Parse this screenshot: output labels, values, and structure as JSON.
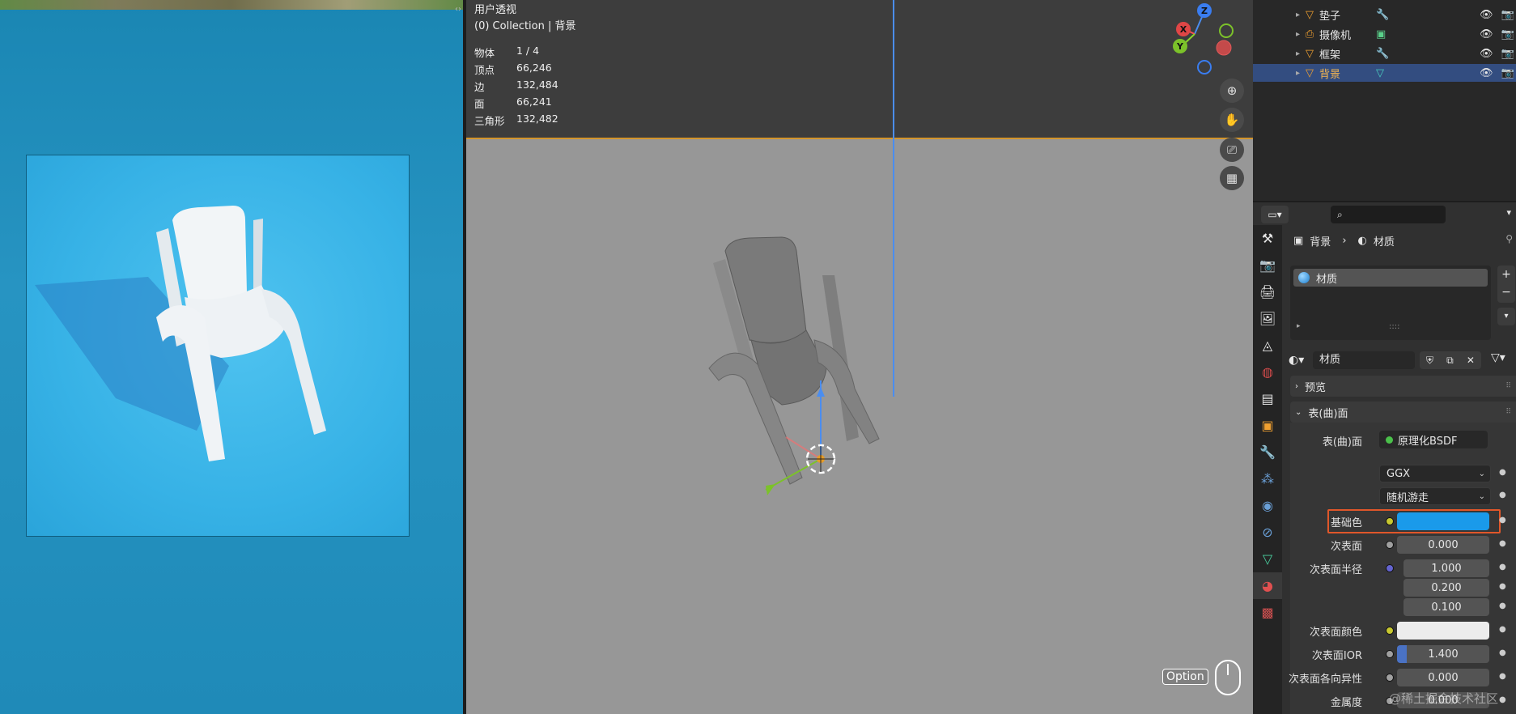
{
  "viewport": {
    "view_name": "用户透视",
    "collection_line": "(0) Collection | 背景",
    "stats": [
      {
        "key": "物体",
        "value": "1 / 4"
      },
      {
        "key": "顶点",
        "value": "66,246"
      },
      {
        "key": "边",
        "value": "132,484"
      },
      {
        "key": "面",
        "value": "66,241"
      },
      {
        "key": "三角形",
        "value": "132,482"
      }
    ],
    "gizmo": {
      "x": "X",
      "y": "Y",
      "z": "Z"
    },
    "option_badge": "Option"
  },
  "outliner": {
    "items": [
      {
        "name": "垫子",
        "selected": false
      },
      {
        "name": "摄像机",
        "selected": false
      },
      {
        "name": "框架",
        "selected": false
      },
      {
        "name": "背景",
        "selected": true
      }
    ]
  },
  "properties": {
    "breadcrumb_object": "背景",
    "breadcrumb_material": "材质",
    "slot_name": "材质",
    "material_name": "材质",
    "panel_preview": "预览",
    "panel_surface": "表(曲)面",
    "surface_label": "表(曲)面",
    "surface_value": "原理化BSDF",
    "distribution": "GGX",
    "subsurface_method": "随机游走",
    "rows": {
      "base_color": "基础色",
      "subsurface": "次表面",
      "subsurface_value": "0.000",
      "subsurface_radius": "次表面半径",
      "radius_values": [
        "1.000",
        "0.200",
        "0.100"
      ],
      "subsurface_color": "次表面颜色",
      "subsurface_ior": "次表面IOR",
      "subsurface_ior_value": "1.400",
      "subsurface_aniso": "次表面各向异性",
      "subsurface_aniso_value": "0.000",
      "metallic": "金属度",
      "metallic_value": "0.000"
    },
    "base_color_hex": "#1a9aea",
    "highlight_color": "#e0572a"
  },
  "watermark": "@稀土掘金技术社区"
}
